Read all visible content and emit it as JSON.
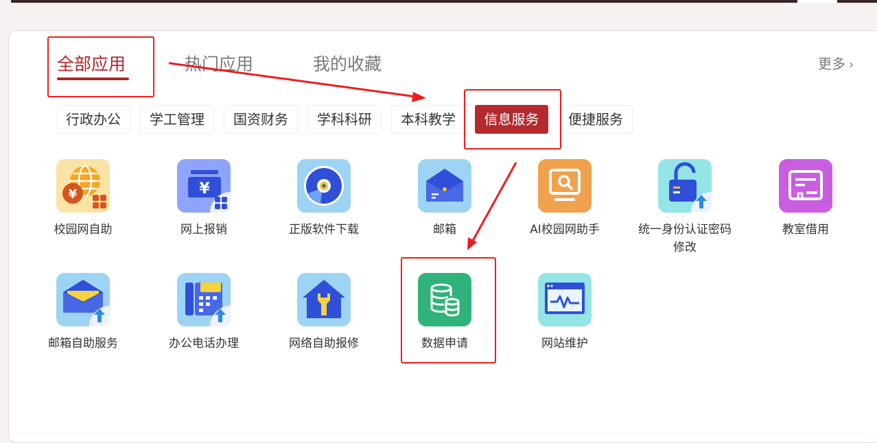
{
  "tabs": [
    {
      "label": "全部应用",
      "active": true
    },
    {
      "label": "热门应用",
      "active": false
    },
    {
      "label": "我的收藏",
      "active": false
    }
  ],
  "more": {
    "label": "更多",
    "icon": "chevron-right-icon"
  },
  "categories": [
    {
      "label": "行政办公"
    },
    {
      "label": "学工管理"
    },
    {
      "label": "国资财务"
    },
    {
      "label": "学科科研"
    },
    {
      "label": "本科教学"
    },
    {
      "label": "信息服务",
      "active": true
    },
    {
      "label": "便捷服务"
    }
  ],
  "apps": [
    {
      "label": "校园网自助",
      "icon": "globe-yuan-icon"
    },
    {
      "label": "网上报销",
      "icon": "reimbursement-icon"
    },
    {
      "label": "正版软件下载",
      "icon": "disc-icon"
    },
    {
      "label": "邮箱",
      "icon": "mail-icon"
    },
    {
      "label": "AI校园网助手",
      "icon": "monitor-search-icon"
    },
    {
      "label": "统一身份认证密码修改",
      "label_lines": [
        "统一身份认证密码",
        "修改"
      ],
      "icon": "unlock-upload-icon"
    },
    {
      "label": "教室借用",
      "icon": "classroom-board-icon"
    },
    {
      "label": "邮箱自助服务",
      "icon": "mail-upload-icon"
    },
    {
      "label": "办公电话办理",
      "icon": "phone-upload-icon"
    },
    {
      "label": "网络自助报修",
      "icon": "house-wrench-icon"
    },
    {
      "label": "数据申请",
      "icon": "database-icon"
    },
    {
      "label": "网站维护",
      "icon": "website-pulse-icon"
    }
  ],
  "colors": {
    "brand_red": "#b02428",
    "category_active_bg": "#b42a2e",
    "annotation_red": "#ee1c1c"
  }
}
